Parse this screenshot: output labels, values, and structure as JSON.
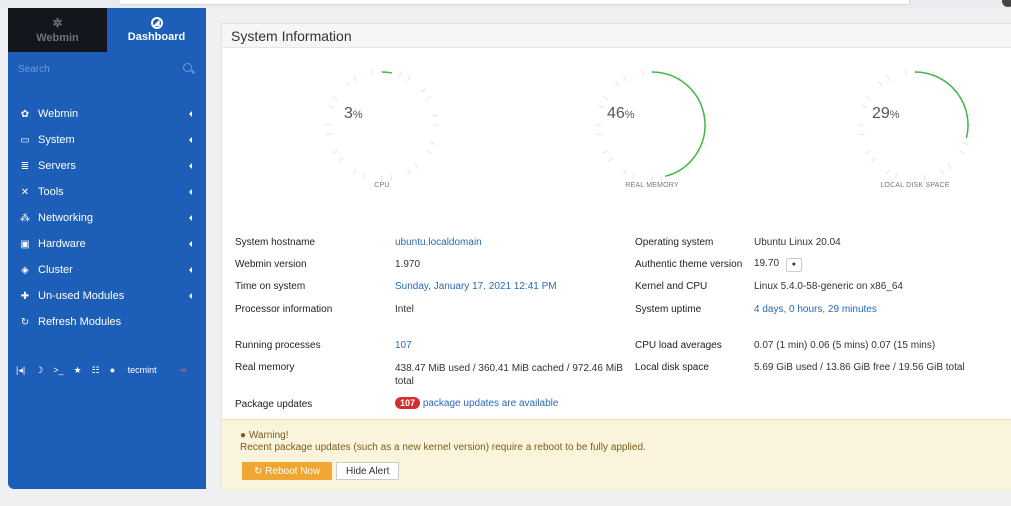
{
  "sidebar": {
    "tab_webmin": "Webmin",
    "tab_dashboard": "Dashboard",
    "search_placeholder": "Search",
    "items": [
      {
        "label": "Webmin",
        "icon": "gear-icon"
      },
      {
        "label": "System",
        "icon": "monitor-icon"
      },
      {
        "label": "Servers",
        "icon": "server-icon"
      },
      {
        "label": "Tools",
        "icon": "tools-icon"
      },
      {
        "label": "Networking",
        "icon": "network-icon"
      },
      {
        "label": "Hardware",
        "icon": "hardware-icon"
      },
      {
        "label": "Cluster",
        "icon": "cluster-icon"
      },
      {
        "label": "Un-used Modules",
        "icon": "puzzle-icon"
      },
      {
        "label": "Refresh Modules",
        "icon": "refresh-icon"
      }
    ],
    "user": "tecmint"
  },
  "main": {
    "title": "System Information"
  },
  "gauges": [
    {
      "value": "3",
      "unit": "%",
      "label": "CPU",
      "fraction": 0.03
    },
    {
      "value": "46",
      "unit": "%",
      "label": "REAL MEMORY",
      "fraction": 0.46
    },
    {
      "value": "29",
      "unit": "%",
      "label": "LOCAL DISK SPACE",
      "fraction": 0.29
    }
  ],
  "info": {
    "hostname_label": "System hostname",
    "hostname_value": "ubuntu.localdomain",
    "webmin_version_label": "Webmin version",
    "webmin_version_value": "1.970",
    "time_label": "Time on system",
    "time_value": "Sunday, January 17, 2021 12:41 PM",
    "processor_label": "Processor information",
    "processor_value": "Intel",
    "processes_label": "Running processes",
    "processes_value": "107",
    "memory_label": "Real memory",
    "memory_value": "438.47 MiB used / 360.41 MiB cached / 972.46 MiB total",
    "updates_label": "Package updates",
    "updates_count": "107",
    "updates_text": "package updates are available",
    "os_label": "Operating system",
    "os_value": "Ubuntu Linux 20.04",
    "theme_label": "Authentic theme version",
    "theme_value": "19.70",
    "kernel_label": "Kernel and CPU",
    "kernel_value": "Linux 5.4.0-58-generic on x86_64",
    "uptime_label": "System uptime",
    "uptime_value": "4 days, 0 hours, 29 minutes",
    "load_label": "CPU load averages",
    "load_value": "0.07 (1 min) 0.06 (5 mins) 0.07 (15 mins)",
    "disk_label": "Local disk space",
    "disk_value": "5.69 GiB used / 13.86 GiB free / 19.56 GiB total"
  },
  "alert": {
    "title": "Warning!",
    "text": "Recent package updates (such as a new kernel version) require a reboot to be fully applied.",
    "reboot_label": "Reboot Now",
    "hide_label": "Hide Alert"
  },
  "colors": {
    "sidebar_bg": "#1c5eb8",
    "gauge_arc": "#43b649",
    "badge_red": "#d32f2f",
    "reboot_button": "#f0a632",
    "link": "#2a6ab8"
  }
}
